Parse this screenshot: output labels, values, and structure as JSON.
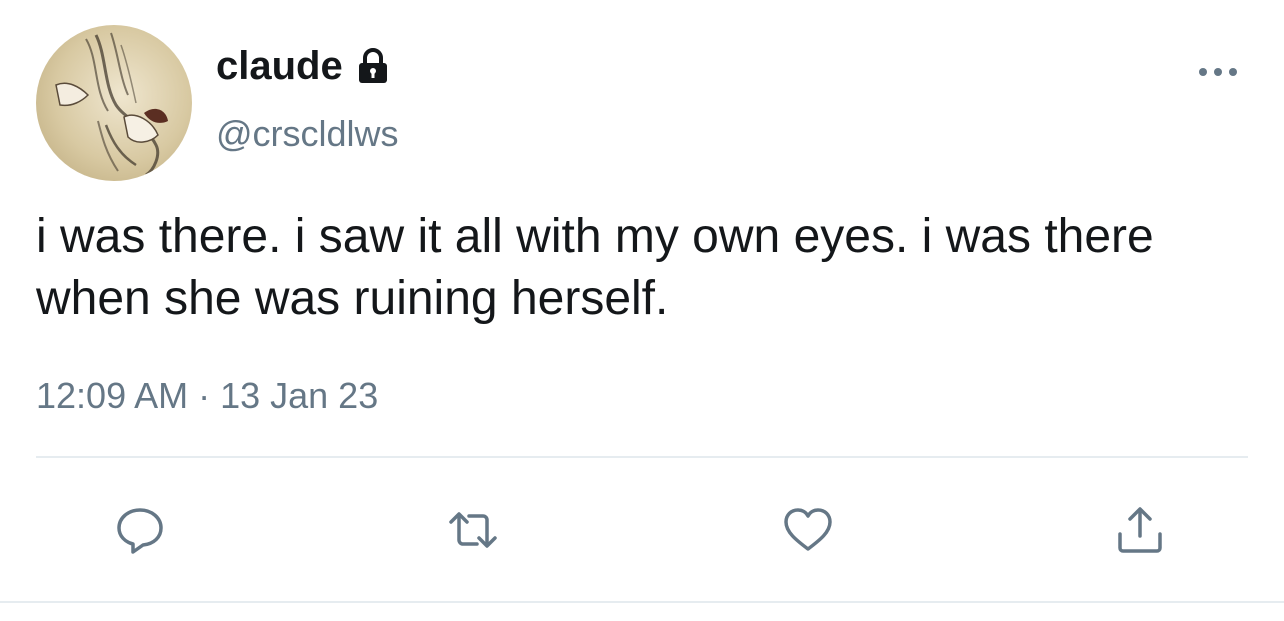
{
  "author": {
    "display_name": "claude",
    "handle": "@crscldlws",
    "protected": true
  },
  "tweet": {
    "text": "i was there. i saw it all with my own eyes. i was there when she was ruining herself.",
    "timestamp": "12:09 AM · 13 Jan 23"
  },
  "icons": {
    "lock": "lock-icon",
    "more": "more-icon",
    "reply": "reply-icon",
    "retweet": "retweet-icon",
    "like": "heart-icon",
    "share": "share-icon"
  },
  "colors": {
    "text": "#14171a",
    "secondary": "#657786",
    "icon": "#657786",
    "divider": "#e6ecf0"
  }
}
